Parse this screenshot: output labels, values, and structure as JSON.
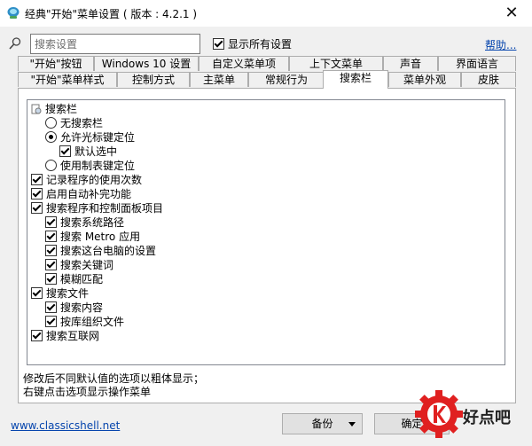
{
  "window": {
    "title": "经典\"开始\"菜单设置 ( 版本 : 4.2.1 )",
    "close_glyph": "✕"
  },
  "toolbar": {
    "search_placeholder": "搜索设置",
    "show_all_label": "显示所有设置",
    "show_all_checked": true,
    "help_label": "帮助..."
  },
  "tabs": {
    "row1": [
      "\"开始\"按钮",
      "Windows 10 设置",
      "自定义菜单项",
      "上下文菜单",
      "声音",
      "界面语言"
    ],
    "row2": [
      "\"开始\"菜单样式",
      "控制方式",
      "主菜单",
      "常规行为",
      "搜索栏",
      "菜单外观",
      "皮肤"
    ],
    "active": "搜索栏"
  },
  "tree": {
    "items": [
      {
        "label": "搜索栏",
        "kind": "group",
        "icon": "settings-group-icon"
      },
      {
        "label": "无搜索栏",
        "kind": "radio",
        "checked": false
      },
      {
        "label": "允许光标键定位",
        "kind": "radio",
        "checked": true
      },
      {
        "label": "默认选中",
        "kind": "checkbox",
        "checked": true
      },
      {
        "label": "使用制表键定位",
        "kind": "radio",
        "checked": false
      },
      {
        "label": "记录程序的使用次数",
        "kind": "checkbox",
        "checked": true
      },
      {
        "label": "启用自动补完功能",
        "kind": "checkbox",
        "checked": true
      },
      {
        "label": "搜索程序和控制面板项目",
        "kind": "checkbox",
        "checked": true
      },
      {
        "label": "搜索系统路径",
        "kind": "checkbox",
        "checked": true
      },
      {
        "label": "搜索 Metro 应用",
        "kind": "checkbox",
        "checked": true
      },
      {
        "label": "搜索这台电脑的设置",
        "kind": "checkbox",
        "checked": true
      },
      {
        "label": "搜索关键词",
        "kind": "checkbox",
        "checked": true
      },
      {
        "label": "模糊匹配",
        "kind": "checkbox",
        "checked": true
      },
      {
        "label": "搜索文件",
        "kind": "checkbox",
        "checked": true
      },
      {
        "label": "搜索内容",
        "kind": "checkbox",
        "checked": true
      },
      {
        "label": "按库组织文件",
        "kind": "checkbox",
        "checked": true
      },
      {
        "label": "搜索互联网",
        "kind": "checkbox",
        "checked": true
      }
    ]
  },
  "notes": {
    "line1": "修改后不同默认值的选项以粗体显示；",
    "line2": "右键点击选项显示操作菜单"
  },
  "footer": {
    "website": "www.classicshell.net",
    "backup_label": "备份",
    "ok_label": "确定"
  },
  "watermark": {
    "text": "好点吧"
  },
  "colors": {
    "accent_link": "#0645ad",
    "watermark_red": "#e02020"
  }
}
